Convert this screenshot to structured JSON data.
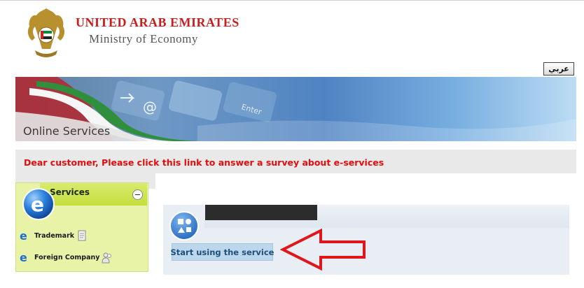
{
  "header": {
    "org_name": "UNITED ARAB EMIRATES",
    "ministry": "Ministry of Economy",
    "language_button": "عربي"
  },
  "banner": {
    "title": "Online Services",
    "key_labels": [
      "Enter"
    ]
  },
  "survey": {
    "link_text": "Dear customer, Please click this link to answer a survey about e-services"
  },
  "sidebar": {
    "title": "Services",
    "items": [
      {
        "label": "Trademark",
        "icon": "trademark-doc-icon"
      },
      {
        "label": "Foreign Company",
        "icon": "foreign-company-users-icon"
      }
    ]
  },
  "service_card": {
    "start_button": "Start using the service"
  },
  "colors": {
    "brand_red": "#c81e1e",
    "survey_red": "#e30d0d",
    "services_green": "#e8f3a8",
    "start_button_bg": "#bcd7ec"
  }
}
